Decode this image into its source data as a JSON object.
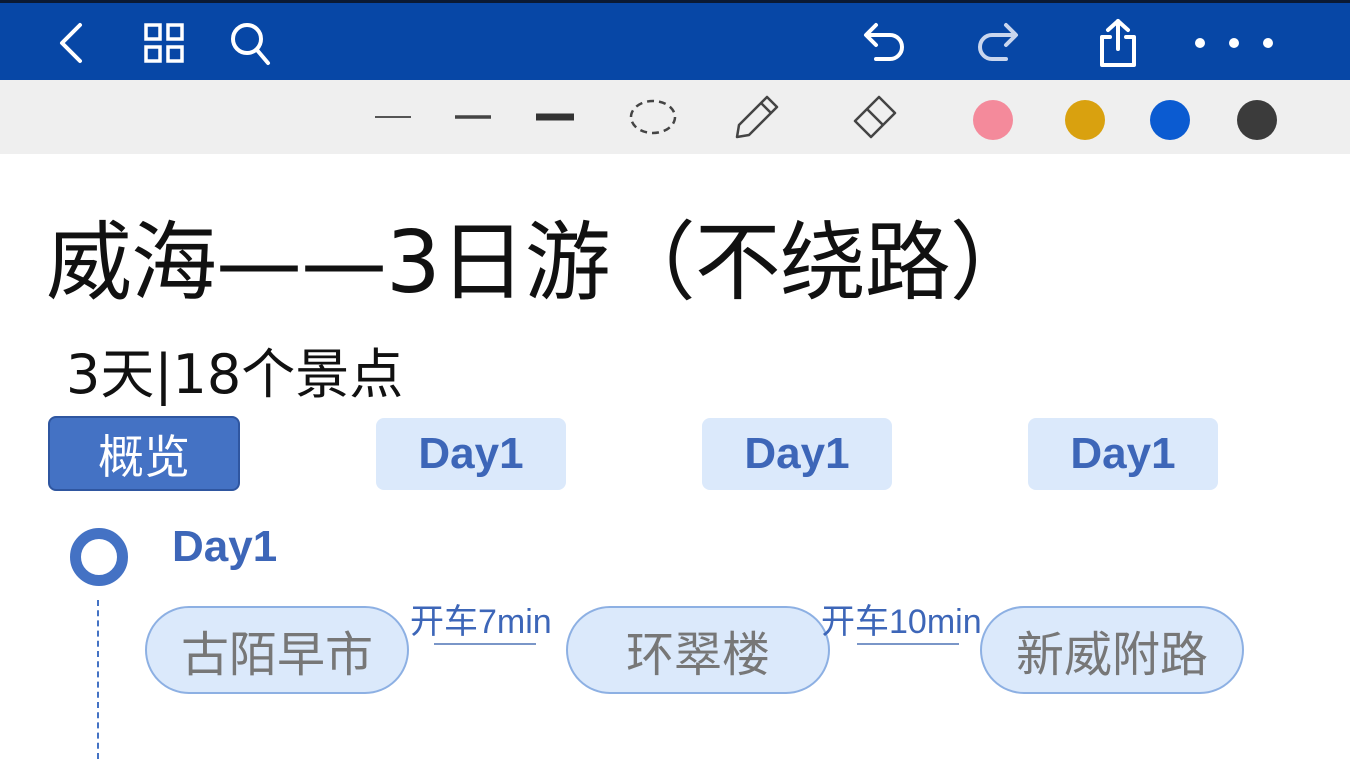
{
  "toolbar": {
    "icons": [
      "back-icon",
      "grid-icon",
      "search-icon",
      "undo-icon",
      "redo-icon",
      "share-icon",
      "more-icon"
    ]
  },
  "pen_toolbar": {
    "tools": [
      "thin-line-tool",
      "medium-line-tool",
      "thick-line-tool",
      "lasso-tool",
      "pencil-tool",
      "eraser-tool"
    ],
    "colors": [
      "#f48a9b",
      "#d9a10f",
      "#0b5bd1",
      "#3b3b3b"
    ]
  },
  "document": {
    "title": "威海——3日游（不绕路）",
    "subtitle": "3天|18个景点",
    "tabs": [
      "概览",
      "Day1",
      "Day1",
      "Day1"
    ],
    "day": {
      "label": "Day1",
      "stops": [
        "古陌早市",
        "环翠楼",
        "新威附路"
      ],
      "legs": [
        "开车7min",
        "开车10min"
      ]
    }
  },
  "colors": {
    "topbar": "#0747a6",
    "accent": "#4472c4",
    "tab_bg": "#dbe9fb",
    "tab_text": "#3d66b8"
  }
}
